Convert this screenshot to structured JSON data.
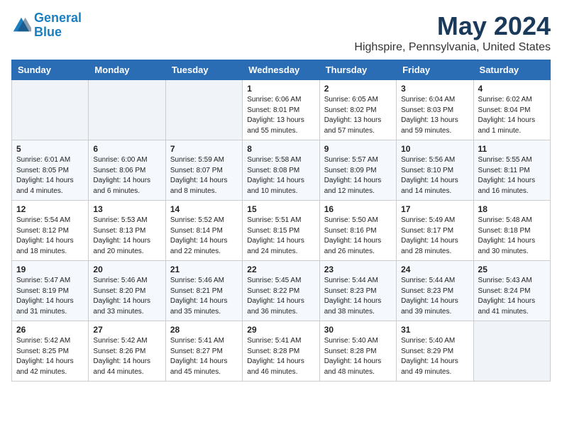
{
  "header": {
    "logo_line1": "General",
    "logo_line2": "Blue",
    "month": "May 2024",
    "location": "Highspire, Pennsylvania, United States"
  },
  "weekdays": [
    "Sunday",
    "Monday",
    "Tuesday",
    "Wednesday",
    "Thursday",
    "Friday",
    "Saturday"
  ],
  "weeks": [
    [
      {
        "day": "",
        "info": ""
      },
      {
        "day": "",
        "info": ""
      },
      {
        "day": "",
        "info": ""
      },
      {
        "day": "1",
        "info": "Sunrise: 6:06 AM\nSunset: 8:01 PM\nDaylight: 13 hours\nand 55 minutes."
      },
      {
        "day": "2",
        "info": "Sunrise: 6:05 AM\nSunset: 8:02 PM\nDaylight: 13 hours\nand 57 minutes."
      },
      {
        "day": "3",
        "info": "Sunrise: 6:04 AM\nSunset: 8:03 PM\nDaylight: 13 hours\nand 59 minutes."
      },
      {
        "day": "4",
        "info": "Sunrise: 6:02 AM\nSunset: 8:04 PM\nDaylight: 14 hours\nand 1 minute."
      }
    ],
    [
      {
        "day": "5",
        "info": "Sunrise: 6:01 AM\nSunset: 8:05 PM\nDaylight: 14 hours\nand 4 minutes."
      },
      {
        "day": "6",
        "info": "Sunrise: 6:00 AM\nSunset: 8:06 PM\nDaylight: 14 hours\nand 6 minutes."
      },
      {
        "day": "7",
        "info": "Sunrise: 5:59 AM\nSunset: 8:07 PM\nDaylight: 14 hours\nand 8 minutes."
      },
      {
        "day": "8",
        "info": "Sunrise: 5:58 AM\nSunset: 8:08 PM\nDaylight: 14 hours\nand 10 minutes."
      },
      {
        "day": "9",
        "info": "Sunrise: 5:57 AM\nSunset: 8:09 PM\nDaylight: 14 hours\nand 12 minutes."
      },
      {
        "day": "10",
        "info": "Sunrise: 5:56 AM\nSunset: 8:10 PM\nDaylight: 14 hours\nand 14 minutes."
      },
      {
        "day": "11",
        "info": "Sunrise: 5:55 AM\nSunset: 8:11 PM\nDaylight: 14 hours\nand 16 minutes."
      }
    ],
    [
      {
        "day": "12",
        "info": "Sunrise: 5:54 AM\nSunset: 8:12 PM\nDaylight: 14 hours\nand 18 minutes."
      },
      {
        "day": "13",
        "info": "Sunrise: 5:53 AM\nSunset: 8:13 PM\nDaylight: 14 hours\nand 20 minutes."
      },
      {
        "day": "14",
        "info": "Sunrise: 5:52 AM\nSunset: 8:14 PM\nDaylight: 14 hours\nand 22 minutes."
      },
      {
        "day": "15",
        "info": "Sunrise: 5:51 AM\nSunset: 8:15 PM\nDaylight: 14 hours\nand 24 minutes."
      },
      {
        "day": "16",
        "info": "Sunrise: 5:50 AM\nSunset: 8:16 PM\nDaylight: 14 hours\nand 26 minutes."
      },
      {
        "day": "17",
        "info": "Sunrise: 5:49 AM\nSunset: 8:17 PM\nDaylight: 14 hours\nand 28 minutes."
      },
      {
        "day": "18",
        "info": "Sunrise: 5:48 AM\nSunset: 8:18 PM\nDaylight: 14 hours\nand 30 minutes."
      }
    ],
    [
      {
        "day": "19",
        "info": "Sunrise: 5:47 AM\nSunset: 8:19 PM\nDaylight: 14 hours\nand 31 minutes."
      },
      {
        "day": "20",
        "info": "Sunrise: 5:46 AM\nSunset: 8:20 PM\nDaylight: 14 hours\nand 33 minutes."
      },
      {
        "day": "21",
        "info": "Sunrise: 5:46 AM\nSunset: 8:21 PM\nDaylight: 14 hours\nand 35 minutes."
      },
      {
        "day": "22",
        "info": "Sunrise: 5:45 AM\nSunset: 8:22 PM\nDaylight: 14 hours\nand 36 minutes."
      },
      {
        "day": "23",
        "info": "Sunrise: 5:44 AM\nSunset: 8:23 PM\nDaylight: 14 hours\nand 38 minutes."
      },
      {
        "day": "24",
        "info": "Sunrise: 5:44 AM\nSunset: 8:23 PM\nDaylight: 14 hours\nand 39 minutes."
      },
      {
        "day": "25",
        "info": "Sunrise: 5:43 AM\nSunset: 8:24 PM\nDaylight: 14 hours\nand 41 minutes."
      }
    ],
    [
      {
        "day": "26",
        "info": "Sunrise: 5:42 AM\nSunset: 8:25 PM\nDaylight: 14 hours\nand 42 minutes."
      },
      {
        "day": "27",
        "info": "Sunrise: 5:42 AM\nSunset: 8:26 PM\nDaylight: 14 hours\nand 44 minutes."
      },
      {
        "day": "28",
        "info": "Sunrise: 5:41 AM\nSunset: 8:27 PM\nDaylight: 14 hours\nand 45 minutes."
      },
      {
        "day": "29",
        "info": "Sunrise: 5:41 AM\nSunset: 8:28 PM\nDaylight: 14 hours\nand 46 minutes."
      },
      {
        "day": "30",
        "info": "Sunrise: 5:40 AM\nSunset: 8:28 PM\nDaylight: 14 hours\nand 48 minutes."
      },
      {
        "day": "31",
        "info": "Sunrise: 5:40 AM\nSunset: 8:29 PM\nDaylight: 14 hours\nand 49 minutes."
      },
      {
        "day": "",
        "info": ""
      }
    ]
  ]
}
